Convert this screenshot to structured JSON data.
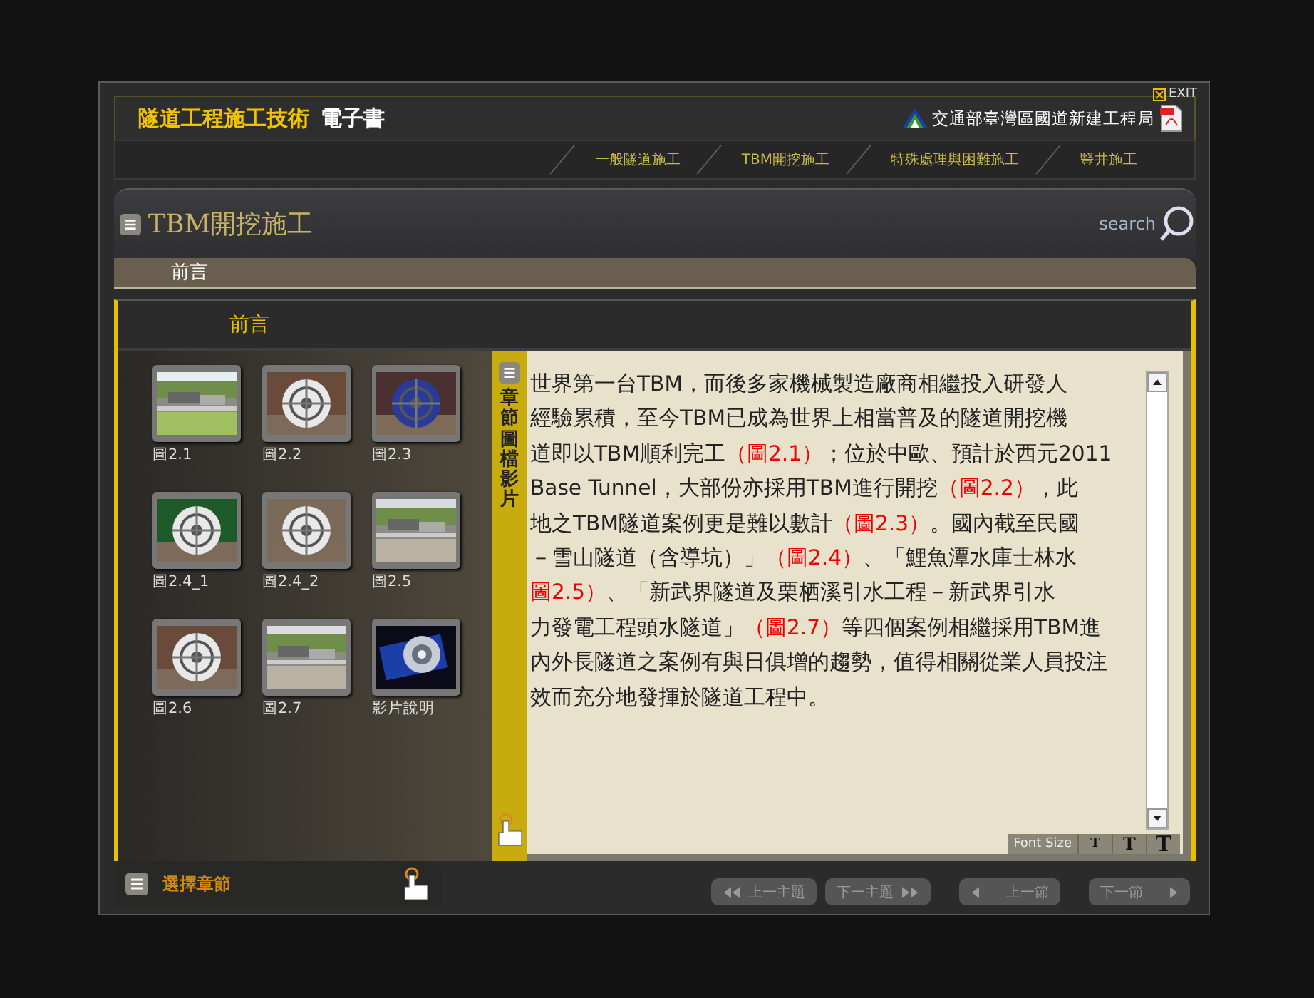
{
  "exit": "EXIT",
  "header": {
    "title": "隧道工程施工技術",
    "subtitle": "電子書",
    "agency": "交通部臺灣區國道新建工程局"
  },
  "nav_tabs": [
    {
      "label": "一般隧道施工"
    },
    {
      "label": "TBM開挖施工"
    },
    {
      "label": "特殊處理與困難施工"
    },
    {
      "label": "豎井施工"
    }
  ],
  "section": {
    "title": "TBM開挖施工",
    "search": "search"
  },
  "breadcrumb": "前言",
  "content_title": "前言",
  "gallery": [
    {
      "label": "圖2.1",
      "kind": "landscape"
    },
    {
      "label": "圖2.2",
      "kind": "cutter"
    },
    {
      "label": "圖2.3",
      "kind": "cutter"
    },
    {
      "label": "圖2.4_1",
      "kind": "cutter"
    },
    {
      "label": "圖2.4_2",
      "kind": "cutter"
    },
    {
      "label": "圖2.5",
      "kind": "landscape"
    },
    {
      "label": "圖2.6",
      "kind": "cutter"
    },
    {
      "label": "圖2.7",
      "kind": "landscape"
    },
    {
      "label": "影片說明",
      "kind": "video"
    }
  ],
  "side_tab": "章節圖檔影片",
  "article": [
    [
      {
        "text": "世界第一台TBM，而後多家機械製造廠商相繼投入研發人",
        "ref": false
      }
    ],
    [
      {
        "text": "經驗累積，至今TBM已成為世界上相當普及的隧道開挖機",
        "ref": false
      }
    ],
    [
      {
        "text": "道即以TBM順利完工",
        "ref": false
      },
      {
        "text": "（圖2.1）",
        "ref": true
      },
      {
        "text": "；位於中歐、預計於西元2011",
        "ref": false
      }
    ],
    [
      {
        "text": "Base Tunnel，大部份亦採用TBM進行開挖",
        "ref": false
      },
      {
        "text": "（圖2.2）",
        "ref": true
      },
      {
        "text": "，此",
        "ref": false
      }
    ],
    [
      {
        "text": "地之TBM隧道案例更是難以數計",
        "ref": false
      },
      {
        "text": "（圖2.3）",
        "ref": true
      },
      {
        "text": "。國內截至民國",
        "ref": false
      }
    ],
    [
      {
        "text": "－雪山隧道（含導坑）」",
        "ref": false
      },
      {
        "text": "（圖2.4）",
        "ref": true
      },
      {
        "text": "、「鯉魚潭水庫士林水",
        "ref": false
      }
    ],
    [
      {
        "text": "圖2.5）",
        "ref": true
      },
      {
        "text": "、「新武界隧道及栗栖溪引水工程－新武界引水",
        "ref": false
      }
    ],
    [
      {
        "text": "力發電工程頭水隧道」",
        "ref": false
      },
      {
        "text": "（圖2.7）",
        "ref": true
      },
      {
        "text": "等四個案例相繼採用TBM進",
        "ref": false
      }
    ],
    [
      {
        "text": "內外長隧道之案例有與日俱增的趨勢，值得相關從業人員投注",
        "ref": false
      }
    ],
    [
      {
        "text": "效而充分地發揮於隧道工程中。",
        "ref": false
      }
    ]
  ],
  "font_size": {
    "label": "Font Size",
    "buttons": [
      {
        "label": "T",
        "kind": "small"
      },
      {
        "label": "T",
        "kind": "medium"
      },
      {
        "label": "T",
        "kind": "large"
      }
    ]
  },
  "chapter_select": "選擇章節",
  "nav_buttons": [
    {
      "label": "上一主題",
      "kind": "prev",
      "double": true
    },
    {
      "label": "下一主題",
      "kind": "next",
      "double": true
    },
    {
      "label": "上一節",
      "kind": "prev",
      "double": false
    },
    {
      "label": "下一節",
      "kind": "next",
      "double": false
    }
  ]
}
